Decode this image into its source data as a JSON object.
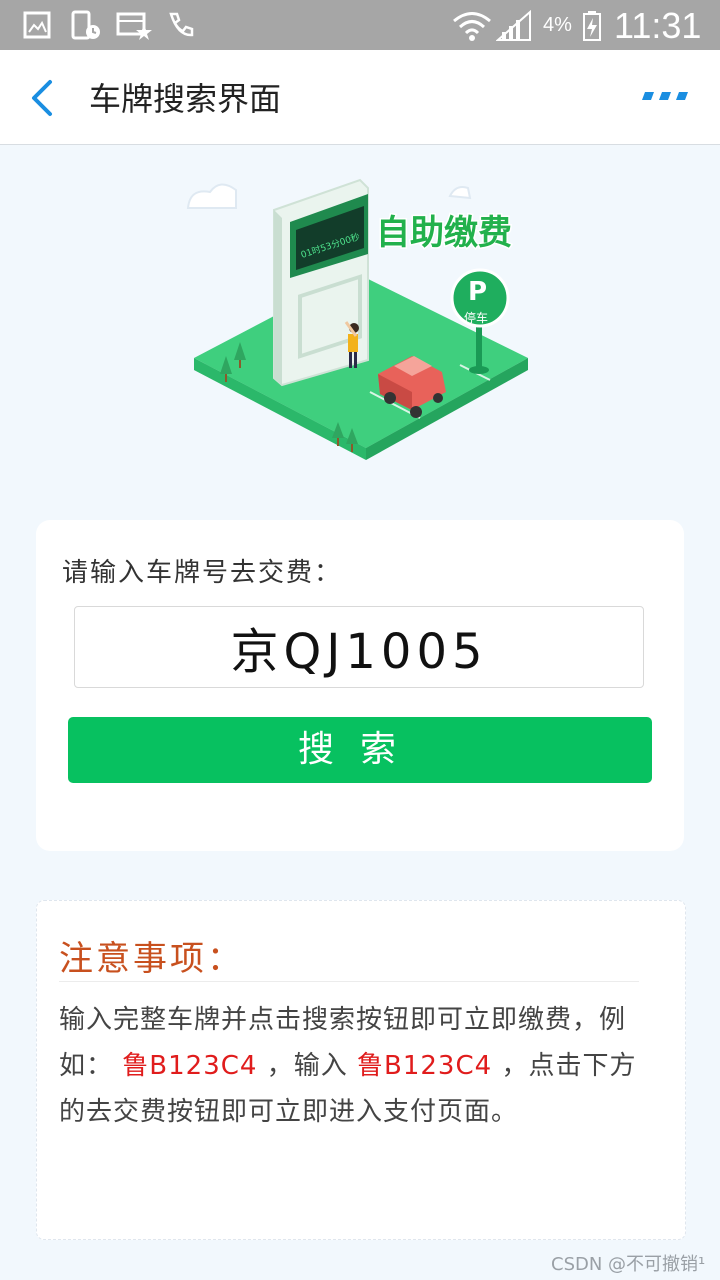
{
  "status_bar": {
    "battery_percent": "4%",
    "time": "11:31"
  },
  "header": {
    "title": "车牌搜索界面"
  },
  "illustration": {
    "banner_text": "自助缴费",
    "sign_timer": "01时53分00秒",
    "parking_sign_letter": "P",
    "parking_sign_text": "停车"
  },
  "search": {
    "prompt": "请输入车牌号去交费：",
    "plate_value": "京QJ1005",
    "button_label": "搜索"
  },
  "notice": {
    "title": "注意事项：",
    "text_1": "输入完整车牌并点击搜索按钮即可立即缴费，例如：",
    "example_1": "鲁B123C4",
    "text_2": "，输入",
    "example_2": "鲁B123C4",
    "text_3": "，点击下方的去交费按钮即可立即进入支付页面。"
  },
  "watermark": "CSDN @不可撤销¹",
  "colors": {
    "accent_green": "#07c160",
    "notice_title": "#c8501e",
    "highlight_red": "#e01c1c",
    "header_icon_blue": "#1a8ee1"
  }
}
